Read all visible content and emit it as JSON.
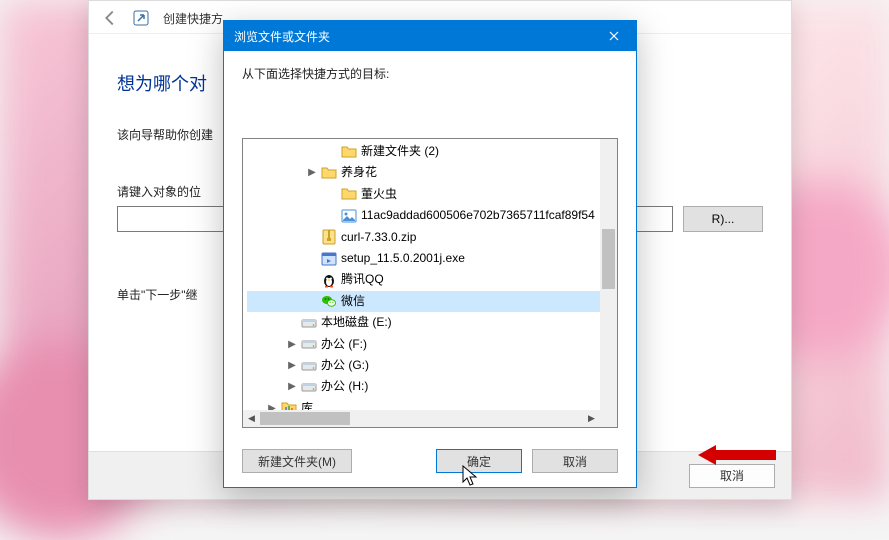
{
  "wizard": {
    "title_partial": "创建快捷方",
    "heading_partial": "想为哪个对",
    "help_partial": "该向导帮助你创建",
    "field_label_partial": "请键入对象的位",
    "browse_button": "R)...",
    "hint_partial": "单击\"下一步\"继",
    "cancel": "取消"
  },
  "dialog": {
    "title": "浏览文件或文件夹",
    "instruction": "从下面选择快捷方式的目标:",
    "tree": [
      {
        "indent": 3,
        "expander": "",
        "icon": "folder",
        "label": "新建文件夹 (2)",
        "sel": false
      },
      {
        "indent": 2,
        "expander": ">",
        "icon": "folder",
        "label": "养身花",
        "sel": false
      },
      {
        "indent": 3,
        "expander": "",
        "icon": "folder",
        "label": "董火虫",
        "sel": false
      },
      {
        "indent": 3,
        "expander": "",
        "icon": "image",
        "label": "11ac9addad600506e702b7365711fcaf89f54",
        "sel": false
      },
      {
        "indent": 2,
        "expander": "",
        "icon": "zip",
        "label": "curl-7.33.0.zip",
        "sel": false
      },
      {
        "indent": 2,
        "expander": "",
        "icon": "exe",
        "label": "setup_11.5.0.2001j.exe",
        "sel": false
      },
      {
        "indent": 2,
        "expander": "",
        "icon": "qq",
        "label": "腾讯QQ",
        "sel": false
      },
      {
        "indent": 2,
        "expander": "",
        "icon": "wechat",
        "label": "微信",
        "sel": true
      },
      {
        "indent": 1,
        "expander": "",
        "icon": "drive",
        "label": "本地磁盘 (E:)",
        "sel": false
      },
      {
        "indent": 1,
        "expander": ">",
        "icon": "drive",
        "label": "办公 (F:)",
        "sel": false
      },
      {
        "indent": 1,
        "expander": ">",
        "icon": "drive",
        "label": "办公 (G:)",
        "sel": false
      },
      {
        "indent": 1,
        "expander": ">",
        "icon": "drive",
        "label": "办公 (H:)",
        "sel": false
      },
      {
        "indent": 0,
        "expander": ">",
        "icon": "library",
        "label": "库",
        "sel": false
      }
    ],
    "new_folder": "新建文件夹(M)",
    "ok": "确定",
    "cancel": "取消"
  },
  "colors": {
    "accent": "#0078d7",
    "selection": "#cce8ff",
    "arrow": "#d40000"
  }
}
